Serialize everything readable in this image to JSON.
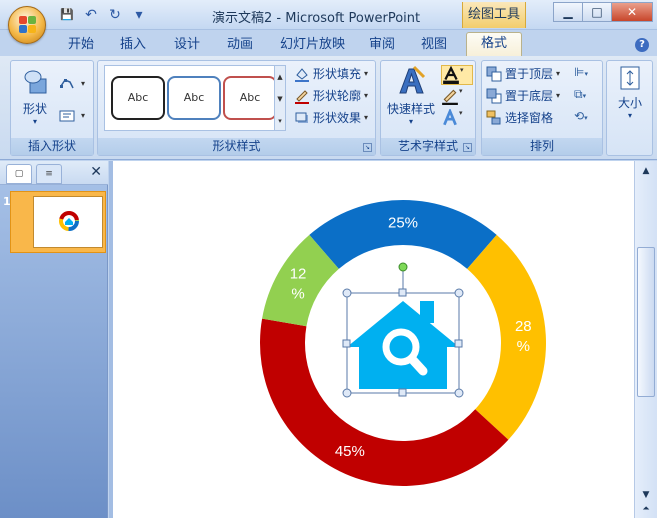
{
  "window": {
    "title": "演示文稿2 - Microsoft PowerPoint",
    "context_tab_title": "绘图工具",
    "buttons": {
      "minimize": "▁",
      "maximize": "□",
      "close": "✕"
    }
  },
  "quick_access": {
    "save": "💾",
    "undo": "↶",
    "redo": "↻",
    "customize": "▾"
  },
  "tabs": [
    "开始",
    "插入",
    "设计",
    "动画",
    "幻灯片放映",
    "审阅",
    "视图",
    "格式"
  ],
  "active_tab": "格式",
  "help": "?",
  "ribbon": {
    "insert_shapes": {
      "shapes_label": "形状",
      "group_label": "插入形状"
    },
    "shape_styles": {
      "samples": [
        "Abc",
        "Abc",
        "Abc"
      ],
      "fill": "形状填充",
      "outline": "形状轮廓",
      "effects": "形状效果",
      "group_label": "形状样式"
    },
    "wordart": {
      "quick_styles": "快速样式",
      "group_label": "艺术字样式"
    },
    "arrange": {
      "bring_front": "置于顶层",
      "send_back": "置于底层",
      "selection_pane": "选择窗格",
      "group_label": "排列"
    },
    "size": {
      "label": "大小"
    }
  },
  "slide_pane": {
    "slide_number": "1",
    "close": "✕"
  },
  "chart_data": {
    "type": "pie",
    "style": "donut",
    "categories": [
      "25%",
      "28%",
      "45%",
      "12%"
    ],
    "values": [
      25,
      28,
      45,
      12
    ],
    "label_lines": [
      [
        "25%"
      ],
      [
        "28",
        "%"
      ],
      [
        "45%"
      ],
      [
        "12",
        "%"
      ]
    ],
    "colors": [
      "#0b6fc7",
      "#ffc000",
      "#c00000",
      "#92d050"
    ],
    "center_icon": "house-search-icon",
    "center_icon_color": "#00b0f0"
  }
}
